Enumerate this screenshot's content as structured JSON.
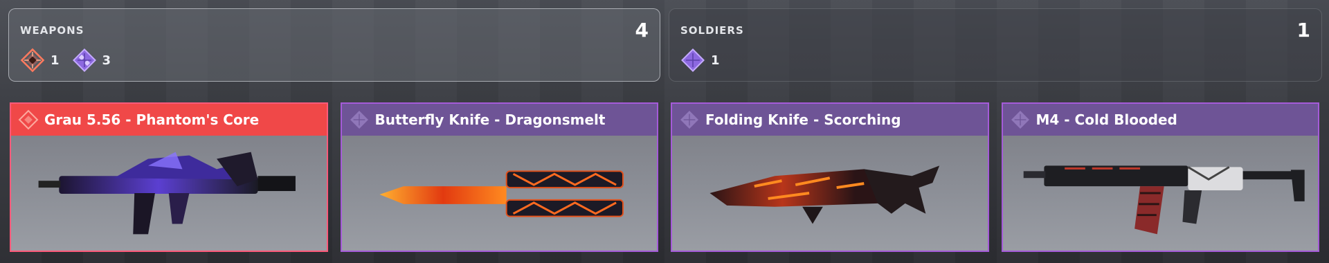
{
  "summary": {
    "weapons": {
      "title": "WEAPONS",
      "total": "4",
      "rarities": [
        {
          "icon": "legendary-rarity-icon",
          "count": "1",
          "color": "#ff6b5b"
        },
        {
          "icon": "epic-rarity-icon",
          "count": "3",
          "color": "#a57cf0"
        }
      ]
    },
    "soldiers": {
      "title": "SOLDIERS",
      "total": "1",
      "rarities": [
        {
          "icon": "epic-rarity-icon",
          "count": "1",
          "color": "#a57cf0"
        }
      ]
    }
  },
  "items": [
    {
      "name": "Grau 5.56 - Phantom's Core",
      "rarity": "legendary",
      "header_color": "#f04848",
      "border_color": "#ff5a7a",
      "icon": "assault-rifle-icon"
    },
    {
      "name": "Butterfly Knife - Dragonsmelt",
      "rarity": "epic",
      "header_color": "#6e5496",
      "border_color": "#a55bd9",
      "icon": "butterfly-knife-icon"
    },
    {
      "name": "Folding Knife - Scorching",
      "rarity": "epic",
      "header_color": "#6e5496",
      "border_color": "#a55bd9",
      "icon": "folding-knife-icon"
    },
    {
      "name": "M4 - Cold Blooded",
      "rarity": "epic",
      "header_color": "#6e5496",
      "border_color": "#a55bd9",
      "icon": "m4-rifle-icon"
    }
  ]
}
